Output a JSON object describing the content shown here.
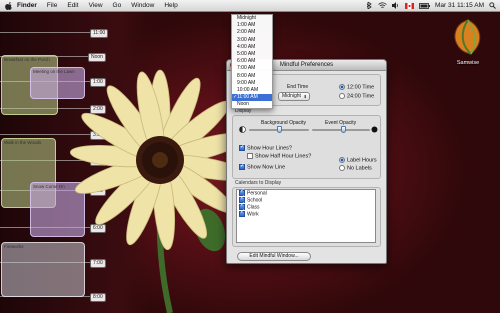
{
  "menubar": {
    "app_name": "Finder",
    "menus": [
      "File",
      "Edit",
      "View",
      "Go",
      "Window",
      "Help"
    ],
    "clock": "Mar 31  11:15 AM"
  },
  "desktop": {
    "drive_label": "Samwise",
    "time_labels": [
      "11:00",
      "Noon",
      "1:00",
      "2:00",
      "3:00",
      "4:00",
      "5:00",
      "6:00",
      "7:00",
      "8:00"
    ],
    "events": [
      {
        "title": "Breakfast on the Porch",
        "color": "green"
      },
      {
        "title": "Meeting on the Lawn",
        "color": "purple"
      },
      {
        "title": "Walk in the Woods",
        "color": "green"
      },
      {
        "title": "Snow Come On",
        "color": "purple"
      },
      {
        "title": "Fireworks",
        "color": "grey"
      }
    ]
  },
  "dropdown": {
    "items": [
      "Midnight",
      "1:00 AM",
      "2:00 AM",
      "3:00 AM",
      "4:00 AM",
      "5:00 AM",
      "6:00 AM",
      "7:00 AM",
      "8:00 AM",
      "9:00 AM",
      "10:00 AM",
      "11:00 AM",
      "Noon"
    ],
    "selected_index": 11
  },
  "prefs": {
    "window_title": "Mindful Preferences",
    "end_time_label": "End Time",
    "end_time_value": "Midnight",
    "clock_12": "12:00 Time",
    "clock_24": "24:00 Time",
    "clock_12_selected": true,
    "display_section": "Display",
    "background_opacity_label": "Background Opacity",
    "event_opacity_label": "Event Opacity",
    "background_opacity": 0.5,
    "event_opacity": 0.55,
    "show_hour_lines": "Show Hour Lines?",
    "show_half_hour_lines": "Show Half Hour Lines?",
    "show_now_line": "Show Now Line",
    "label_hours": "Label Hours",
    "no_labels": "No Labels",
    "calendars_section": "Calendars to Display",
    "calendars": [
      "Personal",
      "School",
      "Class",
      "Work"
    ],
    "edit_button": "Edit Mindful Window..."
  },
  "colors": {
    "selection_blue": "#3a6fd8",
    "event_green": "#bed28c",
    "event_purple": "#c8aae6"
  }
}
